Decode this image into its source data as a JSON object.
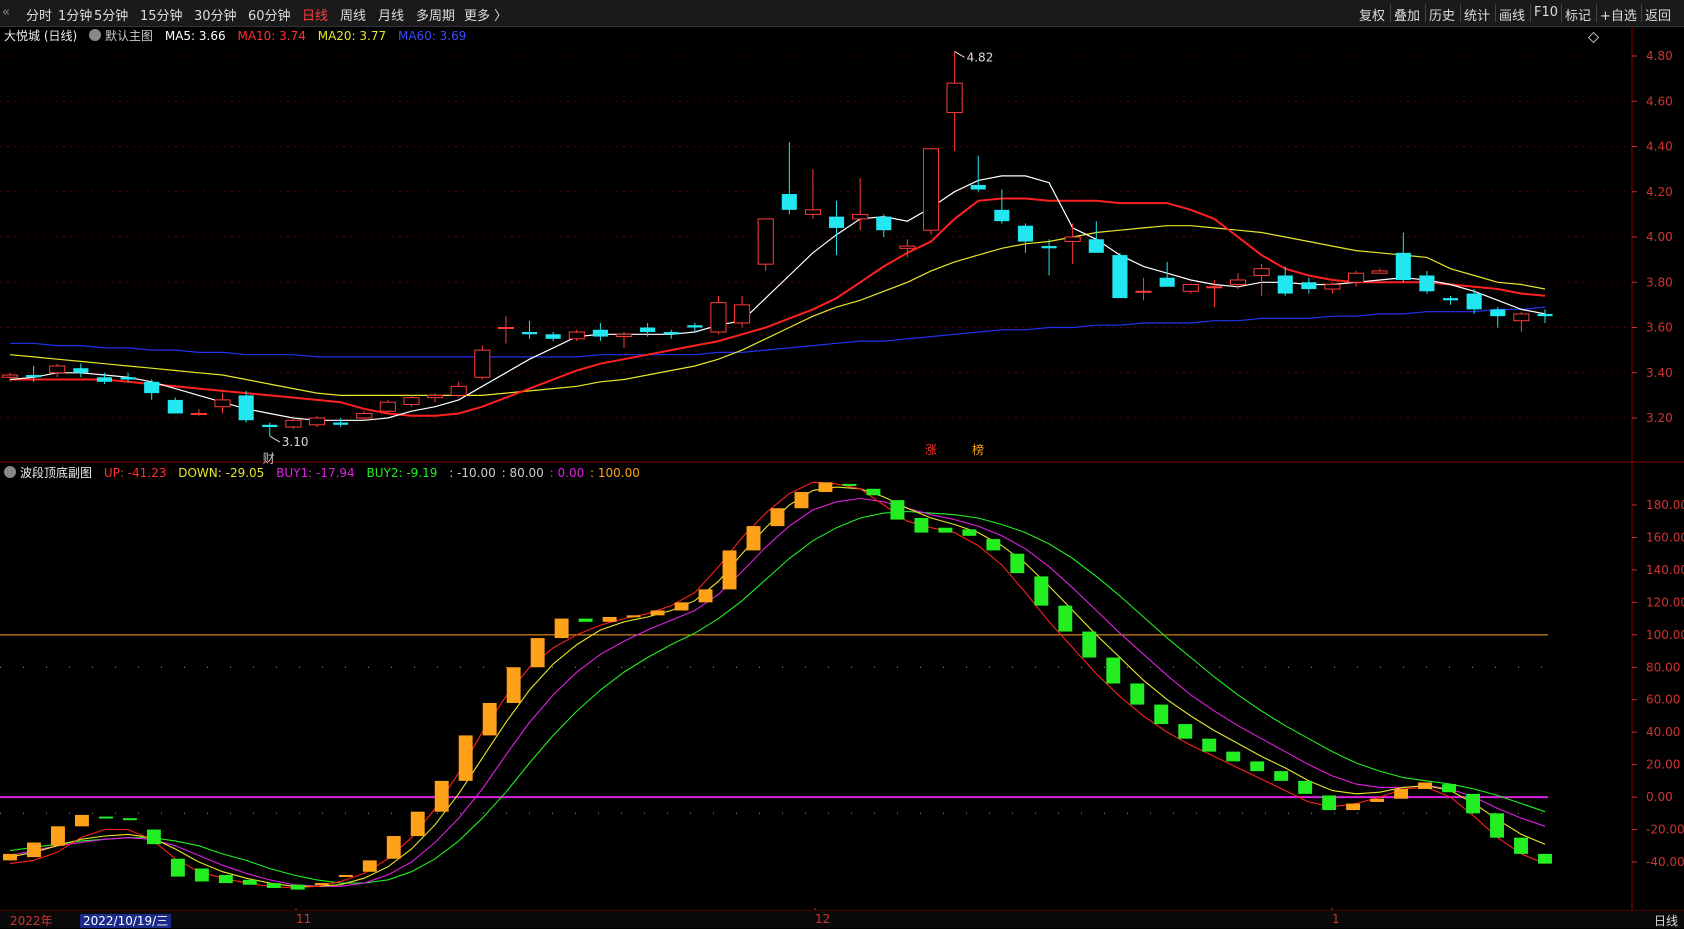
{
  "toolbar": {
    "periods": [
      "分时",
      "1分钟",
      "5分钟",
      "15分钟",
      "30分钟",
      "60分钟",
      "日线",
      "周线",
      "月线",
      "多周期",
      "更多 〉"
    ],
    "active_period": "日线",
    "right_buttons": [
      "复权",
      "叠加",
      "历史",
      "统计",
      "画线",
      "F10",
      "标记",
      "+自选",
      "返回"
    ]
  },
  "main_info": {
    "stock": "大悦城 (日线)",
    "template": "默认主图",
    "ma5": "MA5: 3.66",
    "ma10": "MA10: 3.74",
    "ma20": "MA20: 3.77",
    "ma60": "MA60: 3.69"
  },
  "sub_info": {
    "name": "波段顶底副图",
    "up": "UP: -41.23",
    "down": "DOWN: -29.05",
    "buy1": "BUY1: -17.94",
    "buy2": "BUY2: -9.19",
    "c1": ": -10.00",
    "c2": ": 80.00",
    "c3": ": 0.00",
    "c4": ": 100.00"
  },
  "colors": {
    "up": "#ff3b3b",
    "down": "#22e6f0",
    "ma5": "#ffffff",
    "ma10": "#ff2020",
    "ma20": "#e6e62a",
    "ma60": "#2233ee",
    "orange": "#ffa21a",
    "green": "#22ee22",
    "magenta": "#e020e0",
    "yellow": "#e6e62a",
    "red": "#ff2020",
    "grid": "#5a0000"
  },
  "annotations": {
    "high": "4.82",
    "low": "3.10",
    "low_marker": "财",
    "mark_a": "涨",
    "mark_b": "榜"
  },
  "xaxis": {
    "year": "2022年",
    "date_highlight": "2022/10/19/三",
    "m11": "11",
    "m12": "12",
    "m1": "1",
    "period_tag": "日线"
  },
  "chart_data": [
    {
      "type": "candlestick",
      "title": "大悦城 (日线)",
      "ylim": [
        3.1,
        4.9
      ],
      "yticks": [
        "4.80",
        "4.60",
        "4.40",
        "4.20",
        "4.00",
        "3.80",
        "3.60",
        "3.40",
        "3.20"
      ],
      "candles": [
        [
          3.38,
          3.4,
          3.36,
          3.39
        ],
        [
          3.39,
          3.43,
          3.36,
          3.38
        ],
        [
          3.4,
          3.44,
          3.38,
          3.43
        ],
        [
          3.42,
          3.44,
          3.38,
          3.4
        ],
        [
          3.38,
          3.4,
          3.35,
          3.36
        ],
        [
          3.38,
          3.4,
          3.36,
          3.37
        ],
        [
          3.36,
          3.37,
          3.28,
          3.31
        ],
        [
          3.28,
          3.29,
          3.23,
          3.22
        ],
        [
          3.22,
          3.24,
          3.21,
          3.22
        ],
        [
          3.25,
          3.31,
          3.22,
          3.28
        ],
        [
          3.3,
          3.32,
          3.18,
          3.19
        ],
        [
          3.17,
          3.18,
          3.12,
          3.16
        ],
        [
          3.16,
          3.21,
          3.15,
          3.19
        ],
        [
          3.17,
          3.21,
          3.16,
          3.2
        ],
        [
          3.18,
          3.2,
          3.16,
          3.17
        ],
        [
          3.2,
          3.23,
          3.19,
          3.22
        ],
        [
          3.23,
          3.28,
          3.22,
          3.27
        ],
        [
          3.26,
          3.3,
          3.25,
          3.29
        ],
        [
          3.29,
          3.31,
          3.27,
          3.3
        ],
        [
          3.3,
          3.36,
          3.29,
          3.34
        ],
        [
          3.38,
          3.52,
          3.37,
          3.5
        ],
        [
          3.6,
          3.65,
          3.53,
          3.6
        ],
        [
          3.58,
          3.63,
          3.55,
          3.57
        ],
        [
          3.57,
          3.58,
          3.54,
          3.55
        ],
        [
          3.55,
          3.59,
          3.54,
          3.58
        ],
        [
          3.59,
          3.62,
          3.54,
          3.56
        ],
        [
          3.56,
          3.58,
          3.51,
          3.57
        ],
        [
          3.6,
          3.62,
          3.56,
          3.58
        ],
        [
          3.58,
          3.59,
          3.55,
          3.57
        ],
        [
          3.61,
          3.62,
          3.58,
          3.6
        ],
        [
          3.58,
          3.74,
          3.57,
          3.71
        ],
        [
          3.62,
          3.74,
          3.6,
          3.7
        ],
        [
          3.88,
          4.08,
          3.85,
          4.08
        ],
        [
          4.19,
          4.42,
          4.1,
          4.12
        ],
        [
          4.1,
          4.3,
          4.08,
          4.12
        ],
        [
          4.09,
          4.16,
          3.92,
          4.04
        ],
        [
          4.08,
          4.26,
          4.03,
          4.1
        ],
        [
          4.09,
          4.1,
          4.0,
          4.03
        ],
        [
          3.95,
          3.99,
          3.91,
          3.96
        ],
        [
          4.03,
          4.38,
          4.01,
          4.39
        ],
        [
          4.55,
          4.82,
          4.38,
          4.68
        ],
        [
          4.23,
          4.36,
          4.2,
          4.21
        ],
        [
          4.12,
          4.21,
          4.06,
          4.07
        ],
        [
          4.05,
          4.06,
          3.93,
          3.98
        ],
        [
          3.96,
          3.99,
          3.83,
          3.95
        ],
        [
          3.98,
          4.06,
          3.88,
          4.0
        ],
        [
          3.99,
          4.07,
          3.95,
          3.93
        ],
        [
          3.92,
          3.93,
          3.73,
          3.73
        ],
        [
          3.76,
          3.82,
          3.72,
          3.76
        ],
        [
          3.82,
          3.89,
          3.78,
          3.78
        ],
        [
          3.76,
          3.79,
          3.75,
          3.79
        ],
        [
          3.78,
          3.81,
          3.69,
          3.78
        ],
        [
          3.79,
          3.84,
          3.77,
          3.81
        ],
        [
          3.83,
          3.88,
          3.74,
          3.86
        ],
        [
          3.83,
          3.87,
          3.74,
          3.75
        ],
        [
          3.8,
          3.82,
          3.75,
          3.77
        ],
        [
          3.77,
          3.8,
          3.75,
          3.79
        ],
        [
          3.8,
          3.85,
          3.78,
          3.84
        ],
        [
          3.84,
          3.86,
          3.84,
          3.85
        ],
        [
          3.93,
          4.02,
          3.8,
          3.81
        ],
        [
          3.83,
          3.85,
          3.75,
          3.76
        ],
        [
          3.73,
          3.74,
          3.7,
          3.72
        ],
        [
          3.75,
          3.77,
          3.66,
          3.68
        ],
        [
          3.68,
          3.69,
          3.6,
          3.65
        ],
        [
          3.63,
          3.67,
          3.58,
          3.66
        ],
        [
          3.66,
          3.68,
          3.62,
          3.65
        ]
      ],
      "ma5": [
        3.37,
        3.38,
        3.4,
        3.4,
        3.39,
        3.38,
        3.36,
        3.33,
        3.3,
        3.27,
        3.24,
        3.22,
        3.2,
        3.19,
        3.19,
        3.19,
        3.2,
        3.23,
        3.25,
        3.28,
        3.34,
        3.4,
        3.46,
        3.51,
        3.56,
        3.57,
        3.57,
        3.57,
        3.57,
        3.58,
        3.61,
        3.63,
        3.73,
        3.83,
        3.93,
        4.01,
        4.08,
        4.09,
        4.07,
        4.13,
        4.2,
        4.25,
        4.27,
        4.27,
        4.24,
        4.04,
        3.99,
        3.92,
        3.87,
        3.84,
        3.81,
        3.79,
        3.78,
        3.8,
        3.8,
        3.79,
        3.79,
        3.8,
        3.81,
        3.82,
        3.81,
        3.79,
        3.76,
        3.72,
        3.68,
        3.66
      ],
      "ma10": [
        3.37,
        3.37,
        3.37,
        3.37,
        3.37,
        3.36,
        3.35,
        3.34,
        3.33,
        3.32,
        3.31,
        3.3,
        3.29,
        3.28,
        3.27,
        3.24,
        3.22,
        3.21,
        3.21,
        3.22,
        3.25,
        3.29,
        3.33,
        3.37,
        3.41,
        3.44,
        3.46,
        3.48,
        3.5,
        3.52,
        3.54,
        3.57,
        3.6,
        3.64,
        3.68,
        3.73,
        3.8,
        3.87,
        3.93,
        3.98,
        4.08,
        4.16,
        4.17,
        4.17,
        4.16,
        4.16,
        4.16,
        4.15,
        4.15,
        4.15,
        4.12,
        4.08,
        4.0,
        3.92,
        3.86,
        3.83,
        3.81,
        3.8,
        3.8,
        3.8,
        3.8,
        3.79,
        3.78,
        3.77,
        3.75,
        3.74
      ],
      "ma20": [
        3.48,
        3.47,
        3.46,
        3.45,
        3.44,
        3.43,
        3.42,
        3.41,
        3.4,
        3.39,
        3.37,
        3.35,
        3.33,
        3.31,
        3.3,
        3.3,
        3.3,
        3.3,
        3.3,
        3.3,
        3.3,
        3.31,
        3.32,
        3.33,
        3.34,
        3.36,
        3.37,
        3.39,
        3.41,
        3.43,
        3.46,
        3.5,
        3.55,
        3.6,
        3.65,
        3.69,
        3.72,
        3.76,
        3.8,
        3.85,
        3.89,
        3.92,
        3.95,
        3.97,
        3.98,
        4.0,
        4.02,
        4.03,
        4.04,
        4.05,
        4.05,
        4.04,
        4.03,
        4.02,
        4.0,
        3.98,
        3.96,
        3.94,
        3.93,
        3.92,
        3.91,
        3.86,
        3.83,
        3.8,
        3.79,
        3.77
      ],
      "ma60": [
        3.53,
        3.53,
        3.52,
        3.52,
        3.51,
        3.51,
        3.5,
        3.5,
        3.49,
        3.49,
        3.48,
        3.48,
        3.48,
        3.47,
        3.47,
        3.47,
        3.47,
        3.47,
        3.47,
        3.47,
        3.47,
        3.47,
        3.47,
        3.47,
        3.47,
        3.48,
        3.48,
        3.48,
        3.48,
        3.48,
        3.49,
        3.49,
        3.5,
        3.51,
        3.52,
        3.53,
        3.54,
        3.54,
        3.55,
        3.56,
        3.57,
        3.58,
        3.59,
        3.59,
        3.6,
        3.6,
        3.61,
        3.61,
        3.62,
        3.62,
        3.62,
        3.63,
        3.63,
        3.64,
        3.64,
        3.64,
        3.65,
        3.65,
        3.66,
        3.66,
        3.67,
        3.67,
        3.67,
        3.68,
        3.68,
        3.69
      ]
    },
    {
      "type": "bar",
      "title": "波段顶底副图",
      "ylim": [
        -50,
        200
      ],
      "yticks": [
        "180.00",
        "160.00",
        "140.00",
        "120.00",
        "100.00",
        "80.00",
        "60.00",
        "40.00",
        "20.00",
        "0.00",
        "-20.00",
        "-40.00"
      ],
      "hlines": [
        100,
        0
      ],
      "bars": [
        [
          -39,
          -35
        ],
        [
          -37,
          -28
        ],
        [
          -30,
          -18
        ],
        [
          -18,
          -11
        ],
        [
          -12,
          -13
        ],
        [
          -13,
          -14
        ],
        [
          -20,
          -29
        ],
        [
          -38,
          -49
        ],
        [
          -44,
          -52
        ],
        [
          -48,
          -53
        ],
        [
          -51,
          -54
        ],
        [
          -53,
          -56
        ],
        [
          -54,
          -57
        ],
        [
          -53,
          -53
        ],
        [
          -49,
          -48
        ],
        [
          -46,
          -39
        ],
        [
          -38,
          -24
        ],
        [
          -24,
          -9
        ],
        [
          -9,
          10
        ],
        [
          10,
          38
        ],
        [
          38,
          58
        ],
        [
          58,
          80
        ],
        [
          80,
          98
        ],
        [
          98,
          110
        ],
        [
          110,
          108
        ],
        [
          108,
          111
        ],
        [
          111,
          112
        ],
        [
          112,
          115
        ],
        [
          115,
          120
        ],
        [
          120,
          128
        ],
        [
          128,
          152
        ],
        [
          152,
          167
        ],
        [
          167,
          178
        ],
        [
          178,
          188
        ],
        [
          188,
          194
        ],
        [
          193,
          192
        ],
        [
          190,
          186
        ],
        [
          183,
          171
        ],
        [
          172,
          163
        ],
        [
          166,
          163
        ],
        [
          165,
          161
        ],
        [
          159,
          152
        ],
        [
          150,
          138
        ],
        [
          136,
          118
        ],
        [
          118,
          102
        ],
        [
          102,
          86
        ],
        [
          86,
          70
        ],
        [
          70,
          57
        ],
        [
          57,
          45
        ],
        [
          45,
          36
        ],
        [
          36,
          28
        ],
        [
          28,
          22
        ],
        [
          22,
          16
        ],
        [
          16,
          10
        ],
        [
          10,
          2
        ],
        [
          1,
          -8
        ],
        [
          -8,
          -4
        ],
        [
          -3,
          -1
        ],
        [
          -1,
          5
        ],
        [
          5,
          9
        ],
        [
          8,
          3
        ],
        [
          2,
          -10
        ],
        [
          -10,
          -25
        ],
        [
          -25,
          -35
        ],
        [
          -35,
          -41
        ]
      ],
      "up": [
        -41,
        -39,
        -34,
        -25,
        -20,
        -20,
        -26,
        -38,
        -46,
        -50,
        -53,
        -55,
        -56,
        -55,
        -52,
        -47,
        -38,
        -25,
        -7,
        15,
        40,
        62,
        80,
        92,
        100,
        106,
        110,
        113,
        118,
        126,
        142,
        160,
        175,
        187,
        194,
        193,
        190,
        180,
        170,
        166,
        163,
        155,
        143,
        126,
        108,
        92,
        76,
        62,
        50,
        40,
        32,
        25,
        18,
        11,
        4,
        -3,
        -6,
        -4,
        0,
        5,
        6,
        0,
        -12,
        -25,
        -35,
        -41
      ],
      "down": [
        -37,
        -34,
        -30,
        -26,
        -24,
        -23,
        -25,
        -32,
        -40,
        -46,
        -50,
        -53,
        -55,
        -55,
        -54,
        -50,
        -43,
        -32,
        -17,
        2,
        24,
        46,
        66,
        82,
        94,
        103,
        108,
        111,
        115,
        121,
        133,
        150,
        166,
        180,
        189,
        191,
        190,
        185,
        178,
        172,
        168,
        163,
        155,
        144,
        130,
        115,
        100,
        86,
        72,
        60,
        50,
        41,
        33,
        25,
        18,
        10,
        4,
        2,
        3,
        6,
        7,
        4,
        -4,
        -14,
        -23,
        -29
      ],
      "buy1": [
        -36,
        -33,
        -30,
        -28,
        -26,
        -25,
        -26,
        -30,
        -36,
        -42,
        -47,
        -51,
        -54,
        -55,
        -55,
        -53,
        -48,
        -40,
        -28,
        -13,
        5,
        26,
        46,
        63,
        77,
        88,
        96,
        103,
        109,
        115,
        125,
        139,
        154,
        167,
        177,
        182,
        184,
        182,
        178,
        174,
        171,
        167,
        161,
        153,
        142,
        129,
        115,
        101,
        88,
        75,
        63,
        53,
        44,
        36,
        28,
        20,
        13,
        8,
        6,
        6,
        7,
        5,
        0,
        -7,
        -13,
        -18
      ],
      "buy2": [
        -33,
        -31,
        -29,
        -27,
        -26,
        -25,
        -25,
        -27,
        -30,
        -35,
        -39,
        -44,
        -48,
        -51,
        -53,
        -53,
        -51,
        -46,
        -38,
        -27,
        -13,
        3,
        21,
        38,
        53,
        66,
        77,
        86,
        94,
        101,
        110,
        121,
        134,
        147,
        158,
        166,
        172,
        175,
        176,
        175,
        174,
        172,
        168,
        163,
        156,
        147,
        136,
        124,
        111,
        98,
        86,
        74,
        63,
        53,
        44,
        36,
        28,
        21,
        16,
        12,
        10,
        8,
        5,
        1,
        -4,
        -9
      ]
    }
  ]
}
